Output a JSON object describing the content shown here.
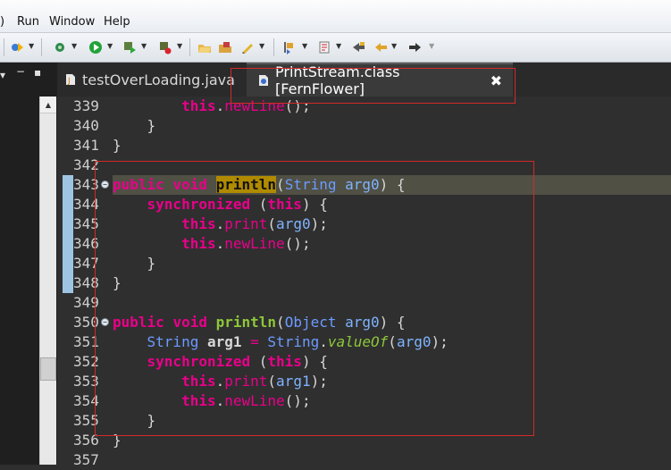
{
  "menubar": {
    "items": [
      ")",
      "Run",
      "Window",
      "Help"
    ]
  },
  "toolbar": {
    "icons": [
      "debug-perspective-icon",
      "debug-icon",
      "run-icon",
      "run-config-icon",
      "external-tools-icon",
      "open-type-icon",
      "open-task-icon",
      "annotation-icon",
      "next-annotation-icon",
      "last-edit-icon",
      "back-icon",
      "forward-icon"
    ]
  },
  "tabs": [
    {
      "label": "testOverLoading.java",
      "active": false
    },
    {
      "label": "PrintStream.class [FernFlower]",
      "active": true
    }
  ],
  "editor": {
    "lines": [
      {
        "n": "339"
      },
      {
        "n": "340"
      },
      {
        "n": "341"
      },
      {
        "n": "342"
      },
      {
        "n": "343"
      },
      {
        "n": "344"
      },
      {
        "n": "345"
      },
      {
        "n": "346"
      },
      {
        "n": "347"
      },
      {
        "n": "348"
      },
      {
        "n": "349"
      },
      {
        "n": "350"
      },
      {
        "n": "351"
      },
      {
        "n": "352"
      },
      {
        "n": "353"
      },
      {
        "n": "354"
      },
      {
        "n": "355"
      },
      {
        "n": "356"
      },
      {
        "n": "357"
      }
    ],
    "tokens": {
      "this": "this",
      "newLine": "newLine",
      "print": "print",
      "public": "public",
      "void": "void",
      "println": "println",
      "String": "String",
      "Object": "Object",
      "arg0": "arg0",
      "arg1": "arg1",
      "synchronized": "synchronized",
      "valueOf": "valueOf"
    }
  },
  "colors": {
    "keyword": "#e9008a",
    "method": "#8dc83a",
    "type": "#6c9bff",
    "annotation_box": "#d32a2a",
    "occurrence_highlight": "#b08b00"
  }
}
